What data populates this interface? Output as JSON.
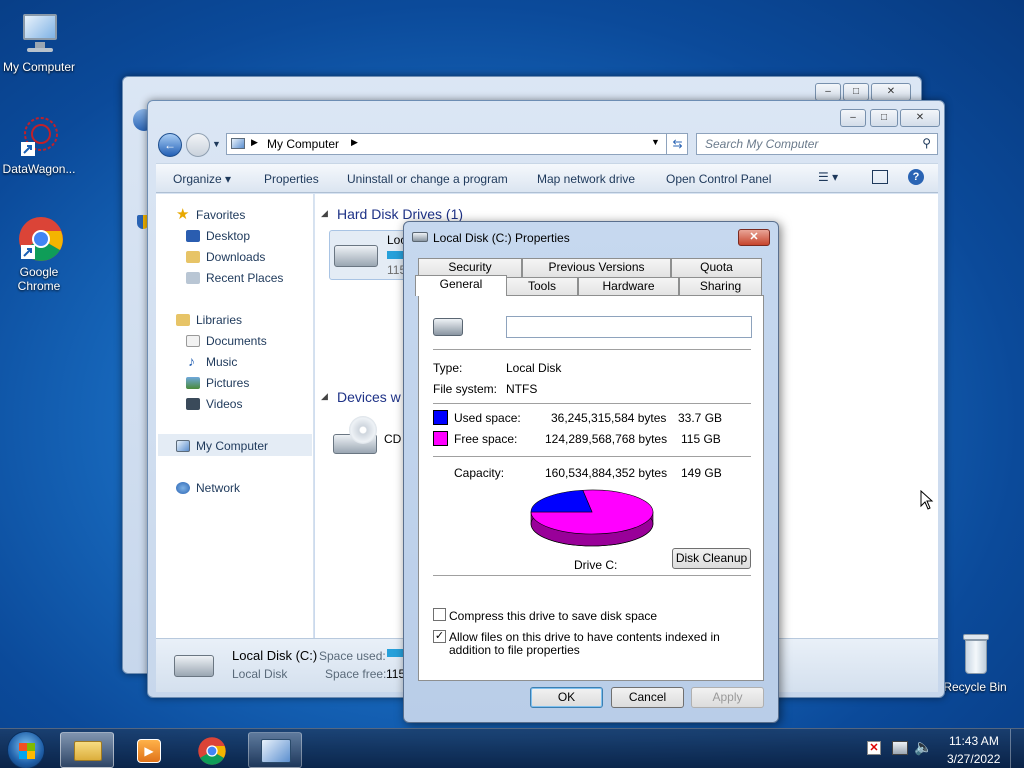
{
  "desktop": {
    "icons": [
      {
        "label": "My Computer",
        "icon": "computer-icon"
      },
      {
        "label": "DataWagon...",
        "icon": "datawagon-icon"
      },
      {
        "label": "Google Chrome",
        "icon": "chrome-icon"
      },
      {
        "label": "Recycle Bin",
        "icon": "recycle-bin-icon"
      }
    ]
  },
  "explorer": {
    "breadcrumb": "My Computer",
    "search_placeholder": "Search My Computer",
    "toolbar": [
      "Organize",
      "Properties",
      "Uninstall or change a program",
      "Map network drive",
      "Open Control Panel"
    ],
    "nav": {
      "favorites": "Favorites",
      "favorite_items": [
        "Desktop",
        "Downloads",
        "Recent Places"
      ],
      "libraries": "Libraries",
      "library_items": [
        "Documents",
        "Music",
        "Pictures",
        "Videos"
      ],
      "computer": "My Computer",
      "network": "Network"
    },
    "content": {
      "group_hdd": "Hard Disk Drives (1)",
      "drive_label_partial": "Loc",
      "drive_size_partial": "115",
      "group_devices_partial": "Devices w",
      "cd_partial": "CD"
    },
    "details": {
      "name": "Local Disk (C:)",
      "type": "Local Disk",
      "space_used_label": "Space used:",
      "space_free_label": "Space free:",
      "space_free_partial": "115"
    }
  },
  "dialog": {
    "title": "Local Disk (C:) Properties",
    "tabs_row1": [
      "Security",
      "Previous Versions",
      "Quota"
    ],
    "tabs_row2": [
      "General",
      "Tools",
      "Hardware",
      "Sharing"
    ],
    "active_tab": "General",
    "name_value": "",
    "type_label": "Type:",
    "type_value": "Local Disk",
    "fs_label": "File system:",
    "fs_value": "NTFS",
    "used_label": "Used space:",
    "used_bytes": "36,245,315,584 bytes",
    "used_gb": "33.7 GB",
    "free_label": "Free space:",
    "free_bytes": "124,289,568,768 bytes",
    "free_gb": "115 GB",
    "capacity_label": "Capacity:",
    "capacity_bytes": "160,534,884,352 bytes",
    "capacity_gb": "149 GB",
    "drive_label": "Drive C:",
    "cleanup_button": "Disk Cleanup",
    "compress_label": "Compress this drive to save disk space",
    "compress_checked": false,
    "index_label": "Allow files on this drive to have contents indexed in addition to file properties",
    "index_checked": true,
    "ok": "OK",
    "cancel": "Cancel",
    "apply": "Apply",
    "colors": {
      "used": "#0000ff",
      "free": "#ff00ff"
    },
    "used_fraction": 0.226
  },
  "taskbar": {
    "time": "11:43 AM",
    "date": "3/27/2022"
  }
}
